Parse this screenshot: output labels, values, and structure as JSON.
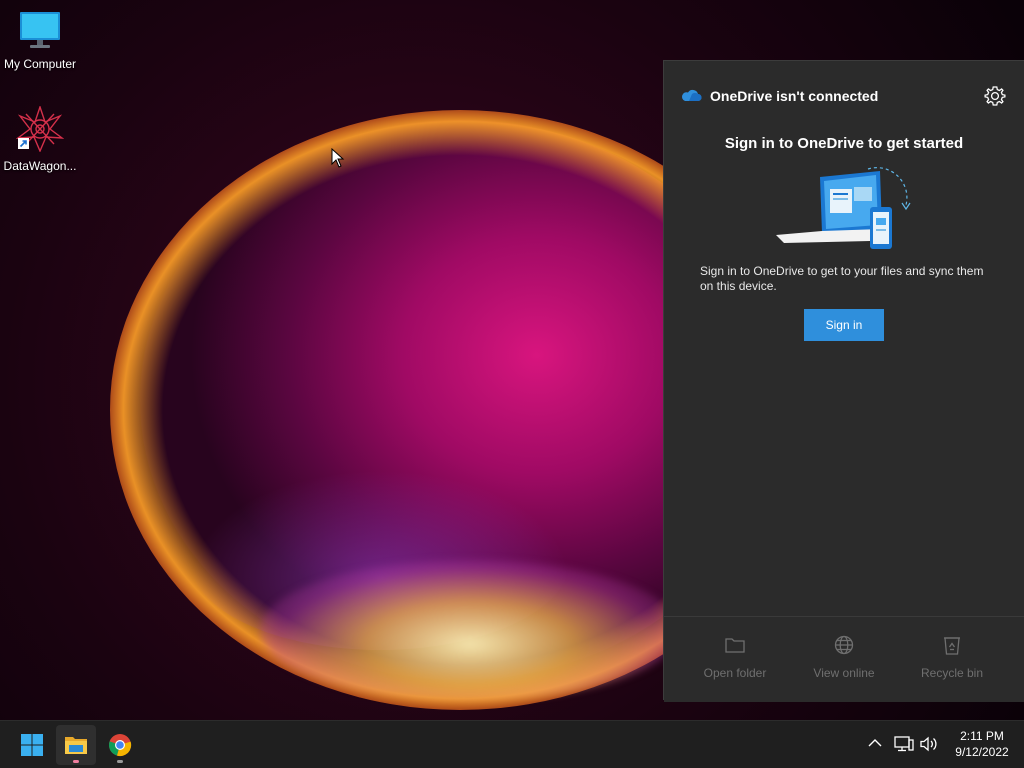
{
  "desktop": {
    "icons": [
      {
        "label": "My Computer",
        "icon": "monitor-icon"
      },
      {
        "label": "DataWagon...",
        "icon": "datawagon-shortcut-icon"
      }
    ]
  },
  "onedrive": {
    "title": "OneDrive isn't connected",
    "heading": "Sign in to OneDrive to get started",
    "description": "Sign in to OneDrive to get to your files and sync them on this device.",
    "signin_label": "Sign in",
    "footer": [
      {
        "label": "Open folder",
        "icon": "folder-icon"
      },
      {
        "label": "View online",
        "icon": "globe-icon"
      },
      {
        "label": "Recycle bin",
        "icon": "recycle-bin-icon"
      }
    ],
    "accent": "#2f8fdc"
  },
  "taskbar": {
    "apps": [
      {
        "name": "Start",
        "icon": "windows-logo-icon"
      },
      {
        "name": "File Explorer",
        "icon": "file-explorer-icon"
      },
      {
        "name": "Google Chrome",
        "icon": "chrome-icon"
      }
    ],
    "clock": {
      "time": "2:11 PM",
      "date": "9/12/2022"
    }
  }
}
